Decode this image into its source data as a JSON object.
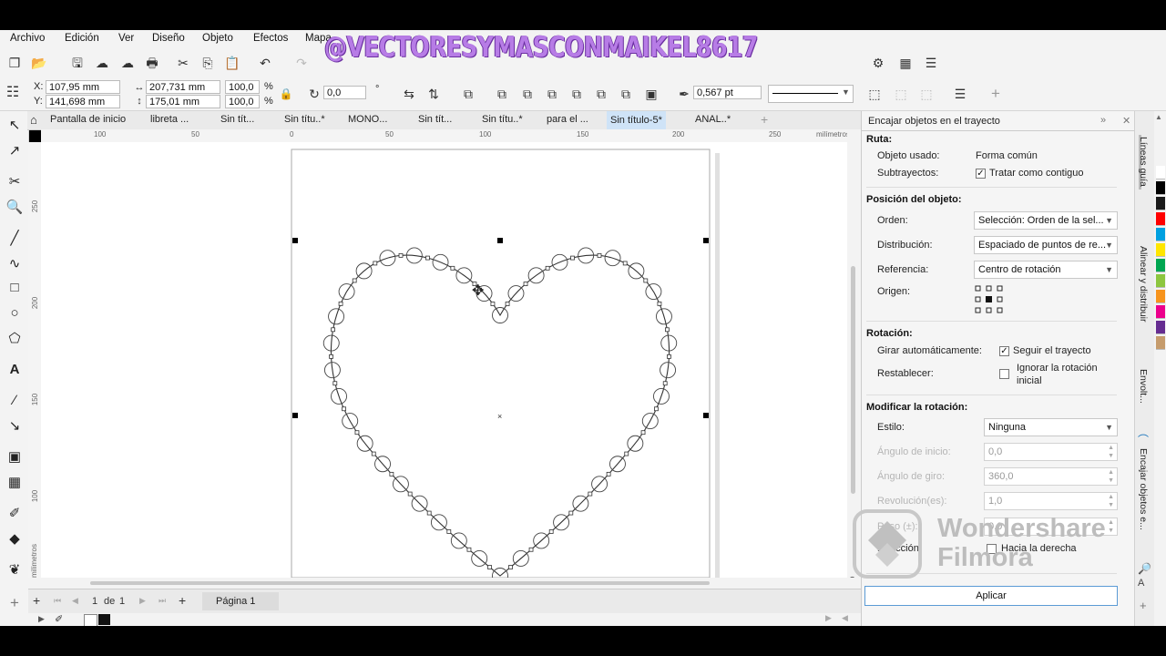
{
  "watermark": "@VECTORESYMASCONMAIKEL8617",
  "menu": [
    "Archivo",
    "Edición",
    "Ver",
    "Diseño",
    "Objeto",
    "Efectos",
    "Mapa"
  ],
  "props": {
    "x": "107,95 mm",
    "y": "141,698 mm",
    "width": "207,731 mm",
    "height": "175,01 mm",
    "scale_x": "100,0",
    "scale_y": "100,0",
    "pct": "%",
    "angle": "0,0",
    "angle_unit": "°",
    "outline_width": "0,567 pt"
  },
  "tabs": [
    "Pantalla de inicio",
    "libreta ...",
    "Sin tít...",
    "Sin títu..*",
    "MONO...",
    "Sin tít...",
    "Sin títu..*",
    "para el ...",
    "Sin título-5*",
    "ANAL..*"
  ],
  "active_tab_index": 8,
  "ruler_h": [
    "100",
    "50",
    "0",
    "50",
    "100",
    "150",
    "200",
    "250",
    "milímetros"
  ],
  "ruler_v": [
    "250",
    "200",
    "150",
    "100",
    "milímetros"
  ],
  "page_nav": {
    "current": "1",
    "of_label": "de",
    "total": "1",
    "page_tab": "Página 1"
  },
  "docker": {
    "title": "Encajar objetos en el trayecto",
    "ruta_section": "Ruta:",
    "objeto_usado_label": "Objeto usado:",
    "objeto_usado_value": "Forma común",
    "subtrayectos_label": "Subtrayectos:",
    "subtrayectos_value": "Tratar como contiguo",
    "posicion_section": "Posición del objeto:",
    "orden_label": "Orden:",
    "orden_value": "Selección: Orden de la sel...",
    "distribucion_label": "Distribución:",
    "distribucion_value": "Espaciado de puntos de re...",
    "referencia_label": "Referencia:",
    "referencia_value": "Centro de rotación",
    "origen_label": "Origen:",
    "rotacion_section": "Rotación:",
    "girar_label": "Girar automáticamente:",
    "girar_value": "Seguir el trayecto",
    "restablecer_label": "Restablecer:",
    "restablecer_value_1": "Ignorar la rotación",
    "restablecer_value_2": "inicial",
    "modificar_section": "Modificar la rotación:",
    "estilo_label": "Estilo:",
    "estilo_value": "Ninguna",
    "angulo_inicio_label": "Ángulo de inicio:",
    "angulo_inicio_value": "0,0",
    "angulo_giro_label": "Ángulo de giro:",
    "angulo_giro_value": "360,0",
    "revolucion_label": "Revolución(es):",
    "revolucion_value": "1,0",
    "paso_label": "Paso (±):",
    "paso_value": "0,0",
    "direccion_label": "Dirección:",
    "direccion_value": "Hacia la derecha",
    "apply_label": "Aplicar"
  },
  "side_tabs": [
    "Líneas guía",
    "Alinear y distribuir",
    "Envolt...",
    "Encajar objetos e..."
  ],
  "filmora": {
    "line1": "Wondershare",
    "line2": "Filmora"
  },
  "palette_colors": [
    "#ffffff",
    "#000000",
    "#1a1a1a",
    "#ff0000",
    "#00a0e0",
    "#ffe600",
    "#00a651",
    "#8dc63f",
    "#f7941d",
    "#ec008c",
    "#662d91",
    "#c69c6d"
  ]
}
